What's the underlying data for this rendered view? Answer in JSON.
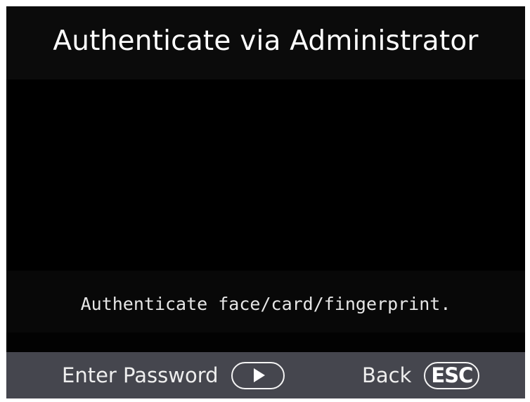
{
  "screen": {
    "title": "Authenticate via Administrator",
    "message": "Authenticate face/card/fingerprint."
  },
  "footer": {
    "password_label": "Enter Password",
    "password_key_icon": "play-right-icon",
    "back_label": "Back",
    "back_key_label": "ESC"
  },
  "colors": {
    "screen_background": "#000000",
    "footer_background": "#45464E",
    "text": "#FFFFFF"
  }
}
